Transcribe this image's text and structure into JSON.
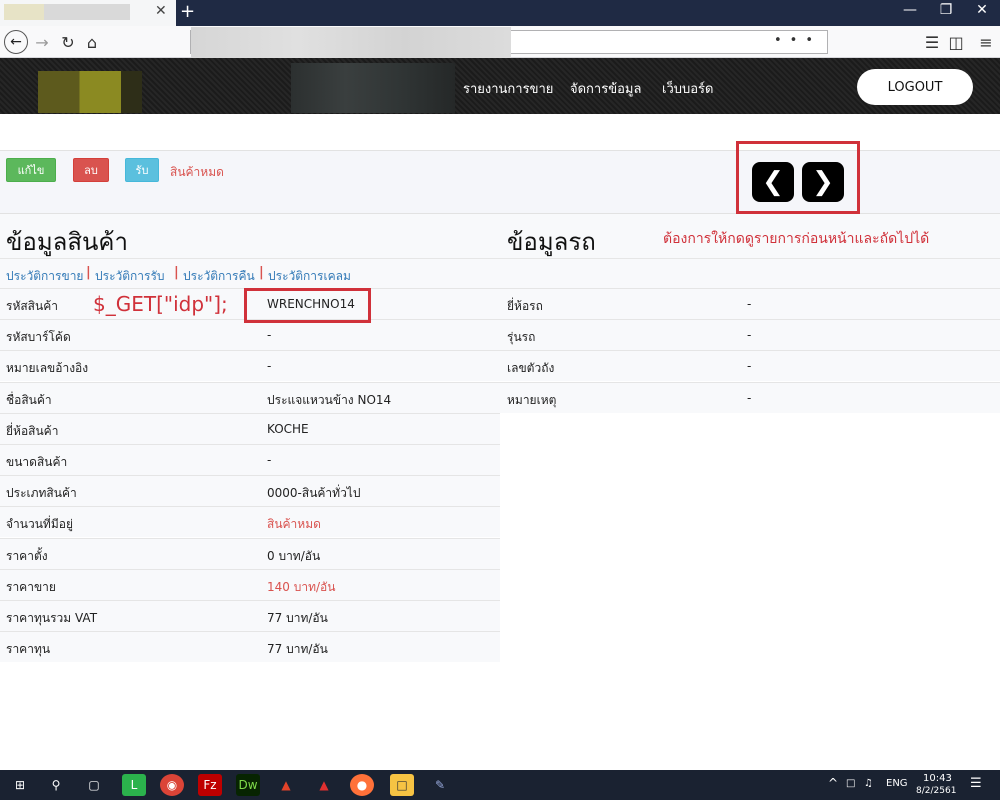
{
  "browser": {
    "tab_close": "✕",
    "new_tab": "+",
    "window_buttons": [
      "—",
      "❐",
      "✕"
    ],
    "url_icons": "•••"
  },
  "header": {
    "menu": [
      "รายงานการขาย",
      "จัดการข้อมูล",
      "เว็บบอร์ด"
    ],
    "logout": "LOGOUT"
  },
  "actions": {
    "edit": "แก้ไข",
    "delete": "ลบ",
    "receive": "รับ",
    "status": "สินค้าหมด"
  },
  "annotations": {
    "get_code": "$_GET[\"idp\"];",
    "request": "ต้องการให้กดดูรายการก่อนหน้าและถัดไปได้"
  },
  "sections": {
    "product_title": "ข้อมูลสินค้า",
    "car_title": "ข้อมูลรถ"
  },
  "history_links": [
    "ประวัติการขาย",
    "ประวัติการรับ",
    "ประวัติการคืน",
    "ประวัติการเคลม"
  ],
  "product_rows": [
    {
      "label": "รหัสสินค้า",
      "value": "WRENCHNO14",
      "highlight": false
    },
    {
      "label": "รหัสบาร์โค้ด",
      "value": "-",
      "highlight": false
    },
    {
      "label": "หมายเลขอ้างอิง",
      "value": "-",
      "highlight": false
    },
    {
      "label": "ชื่อสินค้า",
      "value": "ประแจแหวนข้าง NO14",
      "highlight": false
    },
    {
      "label": "ยี่ห้อสินค้า",
      "value": "KOCHE",
      "highlight": false
    },
    {
      "label": "ขนาดสินค้า",
      "value": "-",
      "highlight": false
    },
    {
      "label": "ประเภทสินค้า",
      "value": "0000-สินค้าทั่วไป",
      "highlight": false
    },
    {
      "label": "จำนวนที่มีอยู่",
      "value": "สินค้าหมด",
      "highlight": true
    },
    {
      "label": "ราคาตั้ง",
      "value": "0 บาท/อัน",
      "highlight": false
    },
    {
      "label": "ราคาขาย",
      "value": "140 บาท/อัน",
      "highlight": true
    },
    {
      "label": "ราคาทุนรวม VAT",
      "value": "77 บาท/อัน",
      "highlight": false
    },
    {
      "label": "ราคาทุน",
      "value": "77 บาท/อัน",
      "highlight": false
    }
  ],
  "car_rows": [
    {
      "label": "ยี่ห้อรถ",
      "value": "-"
    },
    {
      "label": "รุ่นรถ",
      "value": "-"
    },
    {
      "label": "เลขตัวถัง",
      "value": "-"
    },
    {
      "label": "หมายเหตุ",
      "value": "-"
    }
  ],
  "taskbar": {
    "lang": "ENG",
    "time": "10:43",
    "date": "8/2/2561",
    "apps": [
      "windows-icon",
      "search-icon",
      "task-view-icon",
      "line-icon",
      "chrome-icon",
      "filezilla-icon",
      "dreamweaver-icon",
      "gitlab-icon",
      "app-icon",
      "firefox-icon",
      "folder-icon",
      "paint-icon"
    ]
  },
  "colors": {
    "green": "#5cb85c",
    "red": "#d9534f",
    "blue": "#5bc0de",
    "annotation": "#d0313a",
    "link": "#337ab7"
  }
}
